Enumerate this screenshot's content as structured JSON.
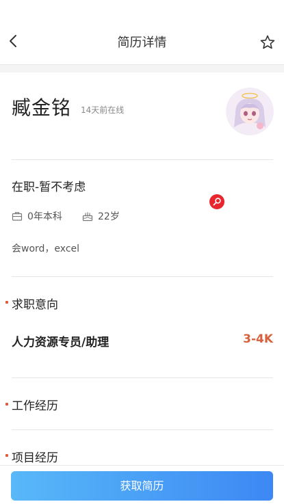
{
  "header": {
    "title": "简历详情"
  },
  "profile": {
    "name": "臧金铭",
    "online": "14天前在线",
    "status": "在职-暂不考虑",
    "education": "0年本科",
    "age": "22岁",
    "skills": "会word，excel"
  },
  "sections": {
    "intention_title": "求职意向",
    "job_title": "人力资源专员/助理",
    "salary": "3-4K",
    "experience_title": "工作经历",
    "project_title": "项目经历"
  },
  "bottom": {
    "button_label": "获取简历"
  },
  "colors": {
    "accent_dot": "#e25b3d",
    "salary": "#d9603c",
    "button_start": "#58b8f8",
    "button_end": "#3d88f4",
    "badge": "#e8262e"
  },
  "icons": [
    "back-arrow-icon",
    "star-icon",
    "briefcase-icon",
    "cake-icon",
    "pin-badge-icon"
  ]
}
